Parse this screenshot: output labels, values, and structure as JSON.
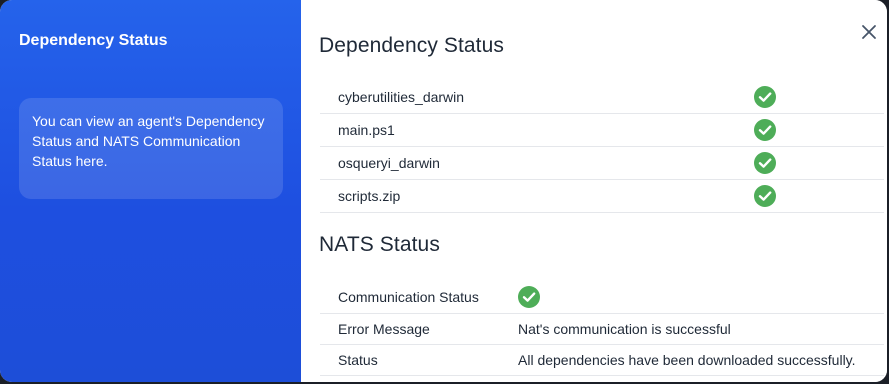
{
  "sidebar": {
    "title": "Dependency Status",
    "info": "You can view an agent's Dependency Status and NATS Communication Status here."
  },
  "dependency": {
    "title": "Dependency Status",
    "rows": [
      {
        "name": "cyberutilities_darwin",
        "status_icon": "check-circle-icon"
      },
      {
        "name": "main.ps1",
        "status_icon": "check-circle-icon"
      },
      {
        "name": "osqueryi_darwin",
        "status_icon": "check-circle-icon"
      },
      {
        "name": "scripts.zip",
        "status_icon": "check-circle-icon"
      }
    ]
  },
  "nats": {
    "title": "NATS Status",
    "rows": [
      {
        "label": "Communication Status",
        "value_icon": "check-circle-icon"
      },
      {
        "label": "Error Message",
        "value": "Nat's communication is successful"
      },
      {
        "label": "Status",
        "value": "All dependencies have been downloaded successfully."
      }
    ]
  },
  "colors": {
    "sidebar_gradient_start": "#2563eb",
    "sidebar_gradient_end": "#1d4ed8",
    "success": "#4ead58",
    "text": "#1f2937",
    "divider": "#e5e7eb"
  },
  "icons": {
    "close": "close-icon",
    "success": "check-circle-icon"
  }
}
